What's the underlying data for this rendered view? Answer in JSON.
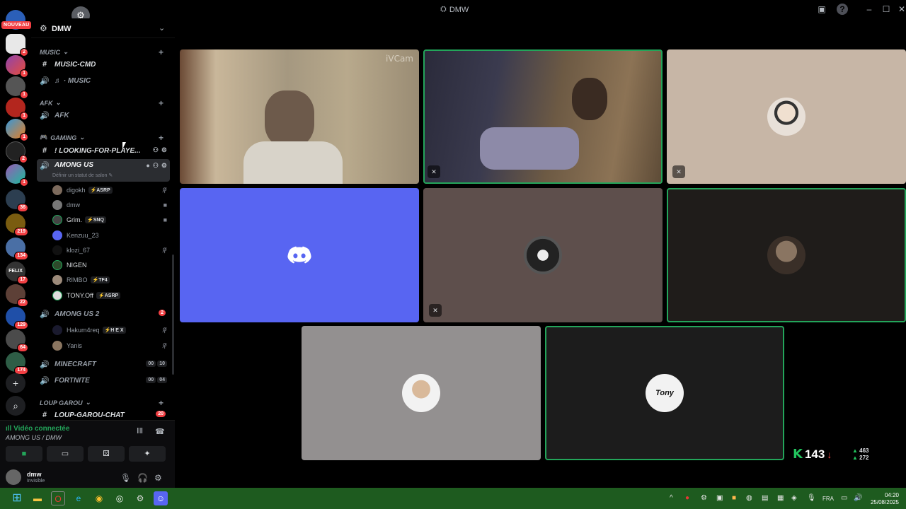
{
  "window": {
    "title": "DMW",
    "min": "–",
    "max": "☐",
    "close": "✕",
    "help": "?",
    "inbox": "▣"
  },
  "colors": {
    "accent": "#5865f2",
    "talking": "#23a55a",
    "badge": "#f23f43",
    "taskbar": "#1e5b1f"
  },
  "rail": {
    "nouveau": "NOUVEAU",
    "servers": [
      {
        "icon": "server-logo",
        "badge": "2"
      },
      {
        "icon": "server-rainbow",
        "badge": "1"
      },
      {
        "icon": "server-grey",
        "badge": "1"
      },
      {
        "icon": "server-red",
        "badge": "1"
      },
      {
        "icon": "server-colorful",
        "badge": "1"
      },
      {
        "icon": "server-dark",
        "badge": "2"
      },
      {
        "icon": "server-purple",
        "badge": "1"
      },
      {
        "icon": "server-anime",
        "badge": "36"
      },
      {
        "icon": "server-gold",
        "badge": "219"
      },
      {
        "icon": "server-blue",
        "badge": "134"
      },
      {
        "icon": "server-felix",
        "badge": "17",
        "label": "FELIX"
      },
      {
        "icon": "server-fighter",
        "badge": "22"
      },
      {
        "icon": "server-blue2",
        "badge": "129"
      },
      {
        "icon": "server-round",
        "badge": "64"
      },
      {
        "icon": "server-ship",
        "badge": "174"
      }
    ],
    "add": "+",
    "discover": "⌕"
  },
  "server": {
    "name": "DMW",
    "chevron": "⌄"
  },
  "categories": [
    {
      "name": "MUSIC",
      "chevron": "⌄",
      "plus": "+"
    },
    {
      "name": "AFK",
      "chevron": "⌄",
      "plus": "+"
    },
    {
      "name": "GAMING",
      "chevron": "⌄",
      "plus": "+"
    },
    {
      "name": "LOUP GAROU",
      "chevron": "⌄",
      "plus": "+"
    }
  ],
  "channels": {
    "music_cmd": {
      "sym": "#",
      "name": "MUSIC-CMD"
    },
    "music": {
      "sym": "🔊",
      "name": "♬ · MUSIC"
    },
    "afk": {
      "sym": "🔊",
      "name": "AFK"
    },
    "looking": {
      "sym": "#",
      "name": "! LOOKING-FOR-PLAYE..."
    },
    "among_us": {
      "sym": "🔊",
      "name": "AMONG US",
      "status": "Définir un statut de salon ✎"
    },
    "among_us_2": {
      "sym": "🔊",
      "name": "AMONG US 2",
      "count": "2"
    },
    "minecraft": {
      "sym": "🔊",
      "name": "MINECRAFT",
      "a": "00",
      "b": "10"
    },
    "fortnite": {
      "sym": "🔊",
      "name": "FORTNITE",
      "a": "00",
      "b": "04"
    },
    "loup_chat": {
      "sym": "#",
      "name": "LOUP-GAROU-CHAT",
      "count": "20"
    }
  },
  "voice_users": [
    {
      "name": "digokh",
      "tag": "⚡ASRP",
      "icon": "mute-icon",
      "glyph": "⚲̸"
    },
    {
      "name": "dmw",
      "tag": "",
      "icon": "camera-icon",
      "glyph": "■"
    },
    {
      "name": "Grim.",
      "tag": "⚡SNQ",
      "icon": "camera-icon",
      "glyph": "■"
    },
    {
      "name": "Kenzuu_23",
      "tag": "",
      "icon": "",
      "glyph": ""
    },
    {
      "name": "klozi_67",
      "tag": "",
      "icon": "mute-icon",
      "glyph": "⚲̸"
    },
    {
      "name": "NIGEN",
      "tag": "",
      "icon": "",
      "glyph": ""
    },
    {
      "name": "RIMBO",
      "tag": "⚡TF4",
      "icon": "",
      "glyph": ""
    },
    {
      "name": "TONY.Off",
      "tag": "⚡ASRP",
      "icon": "",
      "glyph": ""
    }
  ],
  "voice_users_2": [
    {
      "name": "Hakum4req",
      "tag": "⚡H E X",
      "icon": "mute-icon",
      "glyph": "⚲̸"
    },
    {
      "name": "Yanis",
      "tag": "",
      "icon": "mute-icon",
      "glyph": "⚲̸"
    }
  ],
  "voice_panel": {
    "status": "Vidéo connectée",
    "where": "AMONG US / DMW"
  },
  "user_panel": {
    "name": "dmw",
    "status": "Invisible"
  },
  "tiles": {
    "cam1": {
      "watermark": "iVCam"
    },
    "avatar_tony": "Tony"
  },
  "overlay": {
    "k": "K",
    "value": "143",
    "arrow": "↓",
    "up": "463",
    "down": "272"
  },
  "clock": {
    "time": "04:20",
    "date": "25/08/2025"
  },
  "tray": {
    "lang": "FRA",
    "chevron": "^"
  }
}
